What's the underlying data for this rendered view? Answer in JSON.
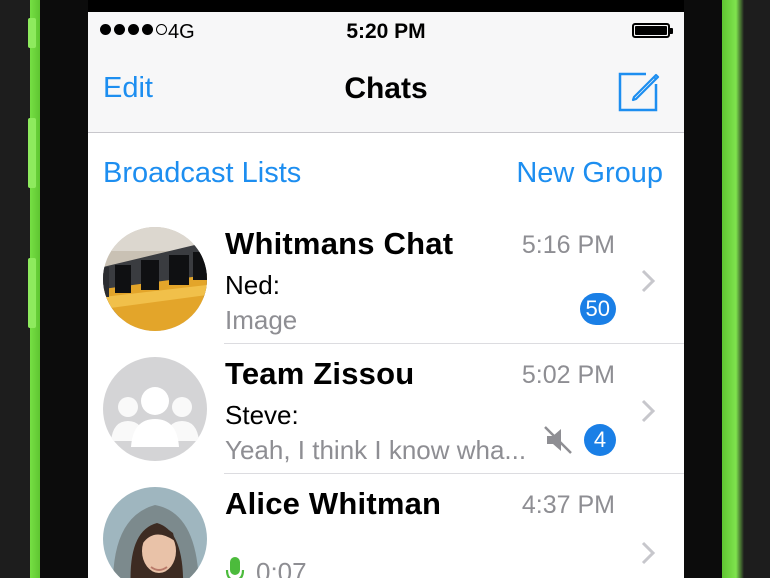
{
  "status_bar": {
    "carrier": "4G",
    "time": "5:20 PM",
    "signal_bars": 4,
    "signal_max": 5,
    "battery_level": 1.0
  },
  "nav": {
    "edit_label": "Edit",
    "title": "Chats",
    "compose_icon": "compose-icon"
  },
  "actions": {
    "broadcast_label": "Broadcast Lists",
    "new_group_label": "New Group"
  },
  "chats": [
    {
      "name": "Whitmans Chat",
      "time": "5:16 PM",
      "sender": "Ned:",
      "preview": "Image",
      "unread": "50",
      "muted": false,
      "avatar": "group-photo-train"
    },
    {
      "name": "Team Zissou",
      "time": "5:02 PM",
      "sender": "Steve:",
      "preview": "Yeah, I think I know wha...",
      "unread": "4",
      "muted": true,
      "avatar": "default-group-avatar"
    },
    {
      "name": "Alice Whitman",
      "time": "4:37 PM",
      "sender": "",
      "preview": "0:07",
      "unread": "",
      "muted": false,
      "avatar": "photo-woman-hood",
      "preview_icon": "microphone-icon"
    }
  ],
  "colors": {
    "accent": "#1d8ef0",
    "badge": "#1a7fe6",
    "device_green": "#6fd63f",
    "mic_green": "#4cbb3c"
  }
}
